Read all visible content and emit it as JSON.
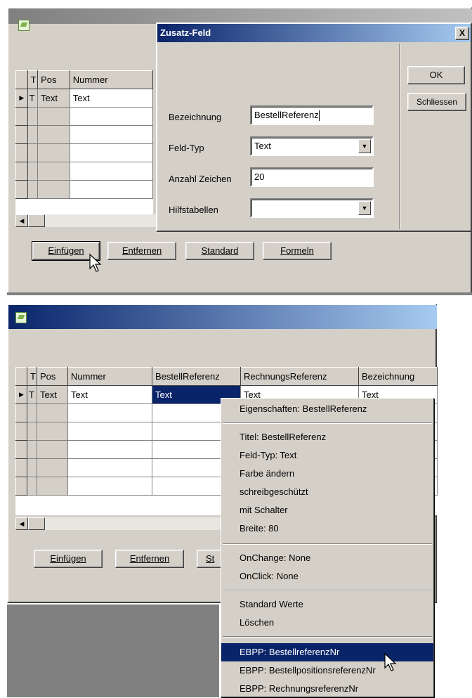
{
  "top_window": {
    "grid": {
      "headers": [
        "T",
        "Pos",
        "Nummer"
      ],
      "rows": [
        {
          "t": "T",
          "pos": "Text",
          "nummer": "Text"
        }
      ]
    },
    "buttons": {
      "einfuegen": "Einfügen",
      "entfernen": "Entfernen",
      "standard": "Standard",
      "formeln": "Formeln"
    }
  },
  "dialog": {
    "title": "Zusatz-Feld",
    "close_glyph": "X",
    "ok_label": "OK",
    "schliessen_label": "Schliessen",
    "fields": {
      "bezeichnung": {
        "label": "Bezeichnung",
        "value": "BestellReferenz"
      },
      "feld_typ": {
        "label": "Feld-Typ",
        "value": "Text"
      },
      "anzahl_zeichen": {
        "label": "Anzahl Zeichen",
        "value": "20"
      },
      "hilfstabellen": {
        "label": "Hilfstabellen",
        "value": ""
      }
    }
  },
  "bottom_window": {
    "grid": {
      "headers": [
        "T",
        "Pos",
        "Nummer",
        "BestellReferenz",
        "RechnungsReferenz",
        "Bezeichnung"
      ],
      "rows": [
        {
          "t": "T",
          "pos": "Text",
          "nummer": "Text",
          "bestell": "Text",
          "rechnung": "Text",
          "bezeichnung": "Text"
        }
      ]
    },
    "buttons": {
      "einfuegen": "Einfügen",
      "entfernen": "Entfernen",
      "standard_partial": "St"
    }
  },
  "context_menu": {
    "header": "Eigenschaften: BestellReferenz",
    "group1": [
      "Titel: BestellReferenz",
      "Feld-Typ: Text",
      "Farbe ändern",
      "schreibgeschützt",
      "mit Schalter",
      "Breite: 80"
    ],
    "group2": [
      "OnChange: None",
      "OnClick: None"
    ],
    "group3": [
      "Standard Werte",
      "Löschen"
    ],
    "group4": [
      "EBPP: BestellreferenzNr",
      "EBPP: BestellpositionsreferenzNr",
      "EBPP: RechnungsreferenzNr"
    ],
    "highlighted": "EBPP: BestellreferenzNr"
  },
  "colors": {
    "face": "#d4d0c8",
    "highlight": "#0a246a",
    "desktop_gray": "#808080"
  }
}
